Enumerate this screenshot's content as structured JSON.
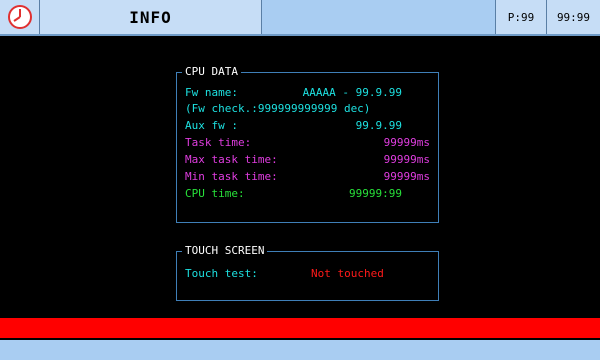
{
  "header": {
    "clock_icon": "clock-icon",
    "title": "INFO",
    "page_label": "P:99",
    "time": "99:99"
  },
  "cpu": {
    "title": "CPU DATA",
    "fw_name_label": "Fw name:",
    "fw_name_value": "AAAAA - 99.9.99",
    "fw_check": "(Fw check.:999999999999 dec)",
    "aux_fw_label": "Aux fw :",
    "aux_fw_value": "99.9.99",
    "task_time_label": "Task time:",
    "task_time_value": "99999ms",
    "max_task_time_label": "Max task time:",
    "max_task_time_value": "99999ms",
    "min_task_time_label": "Min task time:",
    "min_task_time_value": "99999ms",
    "cpu_time_label": "CPU time:",
    "cpu_time_value": "99999:99"
  },
  "touch": {
    "title": "TOUCH SCREEN",
    "test_label": "Touch test:",
    "test_value": "Not touched"
  },
  "colors": {
    "header_bg": "#a9cdf2",
    "accent_cyan": "#1de0e0",
    "accent_magenta": "#e03de0",
    "accent_green": "#28e03a",
    "alarm_red": "#ff0000"
  }
}
